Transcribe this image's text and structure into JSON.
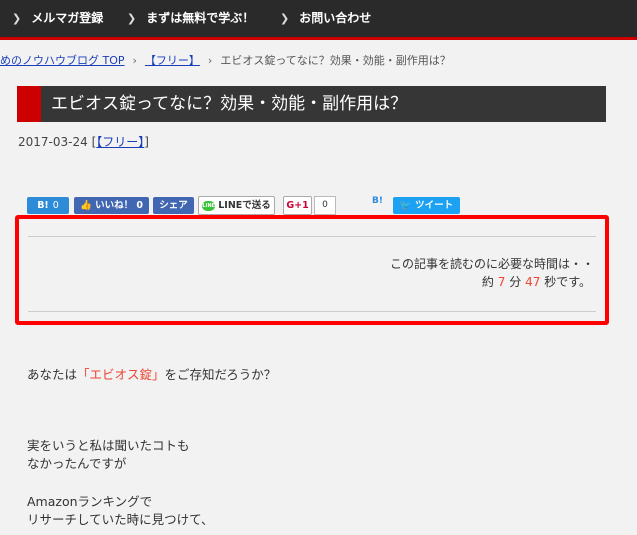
{
  "nav": {
    "items": [
      {
        "label": "メルマガ登録"
      },
      {
        "label": "まずは無料で学ぶ！"
      },
      {
        "label": "お問い合わせ"
      }
    ]
  },
  "breadcrumb": {
    "home": "めのノウハウブログ TOP",
    "category": "【フリー】",
    "current": "エビオス錠ってなに？効果・効能・副作用は？",
    "separator": "›"
  },
  "article": {
    "title": "エビオス錠ってなに？効果・効能・副作用は？",
    "date": "2017-03-24",
    "category_open": "[",
    "category": "【フリー】",
    "category_close": "]"
  },
  "share": {
    "hatena_label": "B!",
    "hatena_count": "0",
    "fb_like_label": "いいね！",
    "fb_like_count": "0",
    "fb_share_label": "シェア",
    "line_label": "LINEで送る",
    "line_icon_text": "LINE",
    "gplus_label": "G+1",
    "gplus_count": "0",
    "hatena_bookmark_icon": "B!",
    "tweet_label": "ツイート"
  },
  "reading_time": {
    "line1": "この記事を読むのに必要な時間は・・",
    "prefix": "約",
    "minutes": "7",
    "minutes_unit": "分",
    "seconds": "47",
    "seconds_unit": "秒です。"
  },
  "body": {
    "p1_before": "あなたは",
    "p1_highlight": "「エビオス錠」",
    "p1_after": "をご存知だろうか？",
    "p2_line1": "実をいうと私は聞いたコトも",
    "p2_line2": "なかったんですが",
    "p3_line1": "Amazonランキングで",
    "p3_line2": "リサーチしていた時に見つけて、"
  },
  "colors": {
    "nav_bg": "#2a2a2a",
    "accent_red": "#cc0000",
    "highlight_box": "#ff0000",
    "link": "#1a3fb8",
    "number_red": "#e43"
  }
}
